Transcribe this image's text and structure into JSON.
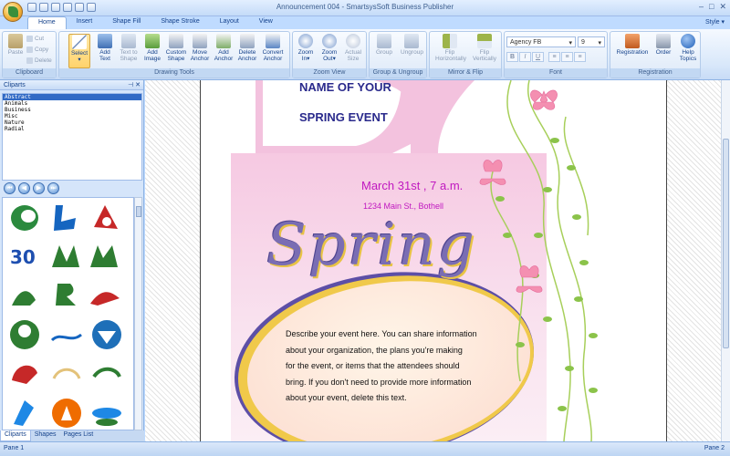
{
  "window": {
    "title": "Announcement 004 - SmartsysSoft Business Publisher",
    "style_menu": "Style"
  },
  "tabs": [
    "Home",
    "Insert",
    "Shape Fill",
    "Shape Stroke",
    "Layout",
    "View"
  ],
  "ribbon": {
    "clipboard": {
      "paste": "Paste",
      "cut": "Cut",
      "copy": "Copy",
      "delete": "Delete",
      "label": "Clipboard"
    },
    "drawing_tools": {
      "label": "Drawing Tools",
      "select": "Select",
      "add_text": "Add Text",
      "text_to_shape": "Text to Shape",
      "add_image": "Add Image",
      "custom_shape": "Custom Shape",
      "move_anchor": "Move Anchor",
      "add_anchor": "Add Anchor",
      "delete_anchor": "Delete Anchor",
      "convert_anchor": "Convert Anchor"
    },
    "zoom_view": {
      "label": "Zoom View",
      "zoom_in": "Zoom In",
      "zoom_out": "Zoom Out",
      "actual_size": "Actual Size"
    },
    "group_ungroup": {
      "label": "Group & Ungroup",
      "group": "Group",
      "ungroup": "Ungroup"
    },
    "mirror_flip": {
      "label": "Mirror & Flip",
      "flip_h": "Flip Horizontally",
      "flip_v": "Flip Vertically"
    },
    "font": {
      "label": "Font",
      "family": "Agency FB",
      "size": "9",
      "bold": "B",
      "italic": "I",
      "underline": "U"
    },
    "registration": {
      "label": "Registration",
      "registration": "Registration",
      "order": "Order",
      "help": "Help Topics"
    }
  },
  "cliparts_panel": {
    "title": "Cliparts",
    "categories": [
      "Abstract",
      "Animals",
      "Business",
      "Misc",
      "Nature",
      "Radial"
    ],
    "selected_category": "Abstract",
    "bottom_tabs": [
      "Cliparts",
      "Shapes",
      "Pages List"
    ]
  },
  "document": {
    "name_line1": "NAME OF YOUR",
    "name_line2": "SPRING EVENT",
    "date": "March 31st , 7 a.m.",
    "address": "1234 Main St., Bothell",
    "title": "Spring",
    "description_lines": [
      "Describe your event here. You can share information",
      "about your organization, the plans you're making",
      "for the event, or items that the attendees should",
      "bring. If you don't need to provide more information",
      "about your event, delete this text."
    ]
  },
  "status": {
    "left": "Pane 1",
    "right": "Pane 2"
  },
  "colors": {
    "ribbon_text": "#15428b",
    "title_purple": "#7a6db3",
    "event_magenta": "#c018c0",
    "name_navy": "#2a2a8c"
  }
}
